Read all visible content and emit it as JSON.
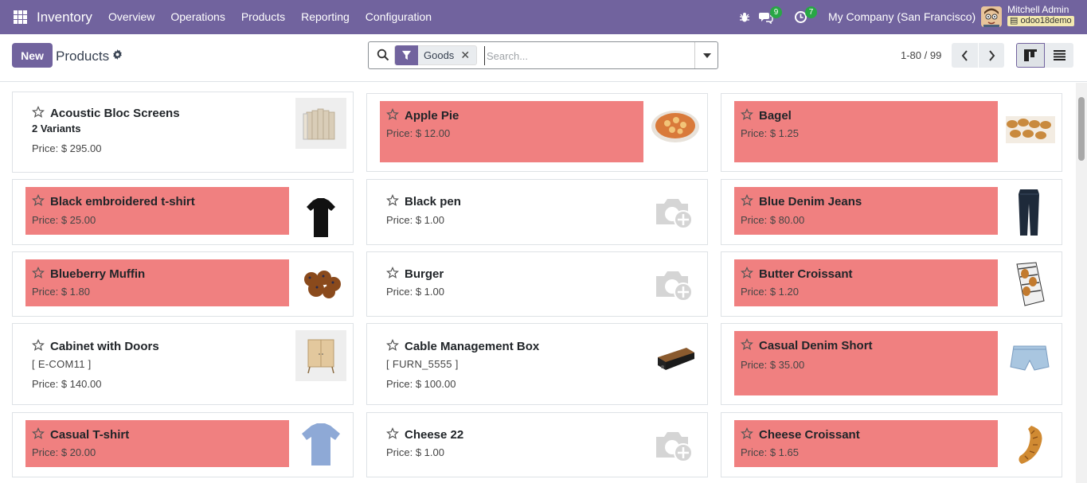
{
  "navbar": {
    "app_name": "Inventory",
    "menu": [
      "Overview",
      "Operations",
      "Products",
      "Reporting",
      "Configuration"
    ],
    "chat_count": "9",
    "activity_count": "7",
    "company": "My Company (San Francisco)",
    "user_name": "Mitchell Admin",
    "db_name": "odoo18demo"
  },
  "control": {
    "new_label": "New",
    "title": "Products",
    "facet_label": "Goods",
    "search_placeholder": "Search...",
    "pager": "1-80 / 99"
  },
  "colors": {
    "brand": "#71639e",
    "highlight": "#f08080",
    "badge": "#28a745"
  },
  "cards": [
    {
      "name": "Acoustic Bloc Screens",
      "variants": "2 Variants",
      "price": "Price: $ 295.00",
      "image": "screen-image",
      "highlighted": false
    },
    {
      "name": "Apple Pie",
      "price": "Price: $ 12.00",
      "image": "pie-image",
      "highlighted": true
    },
    {
      "name": "Bagel",
      "price": "Price: $ 1.25",
      "image": "bagel-image",
      "highlighted": true
    },
    {
      "name": "Black embroidered t-shirt",
      "price": "Price: $ 25.00",
      "image": "black-tshirt-image",
      "highlighted": true
    },
    {
      "name": "Black pen",
      "price": "Price: $ 1.00",
      "image": "camera-placeholder-icon",
      "highlighted": false
    },
    {
      "name": "Blue Denim Jeans",
      "price": "Price: $ 80.00",
      "image": "jeans-image",
      "highlighted": true
    },
    {
      "name": "Blueberry Muffin",
      "price": "Price: $ 1.80",
      "image": "muffin-image",
      "highlighted": true
    },
    {
      "name": "Burger",
      "price": "Price: $ 1.00",
      "image": "camera-placeholder-icon",
      "highlighted": false
    },
    {
      "name": "Butter Croissant",
      "price": "Price: $ 1.20",
      "image": "croissant-bag-image",
      "highlighted": true
    },
    {
      "name": "Cabinet with Doors",
      "ref": "[ E-COM11 ]",
      "price": "Price: $ 140.00",
      "image": "cabinet-image",
      "highlighted": false
    },
    {
      "name": "Cable Management Box",
      "ref": "[ FURN_5555 ]",
      "price": "Price: $ 100.00",
      "image": "cable-box-image",
      "highlighted": false
    },
    {
      "name": "Casual Denim Short",
      "price": "Price: $ 35.00",
      "image": "shorts-image",
      "highlighted": true
    },
    {
      "name": "Casual T-shirt",
      "price": "Price: $ 20.00",
      "image": "blue-tshirt-image",
      "highlighted": true
    },
    {
      "name": "Cheese 22",
      "price": "Price: $ 1.00",
      "image": "camera-placeholder-icon",
      "highlighted": false
    },
    {
      "name": "Cheese Croissant",
      "price": "Price: $ 1.65",
      "image": "croissant-image",
      "highlighted": true
    }
  ]
}
